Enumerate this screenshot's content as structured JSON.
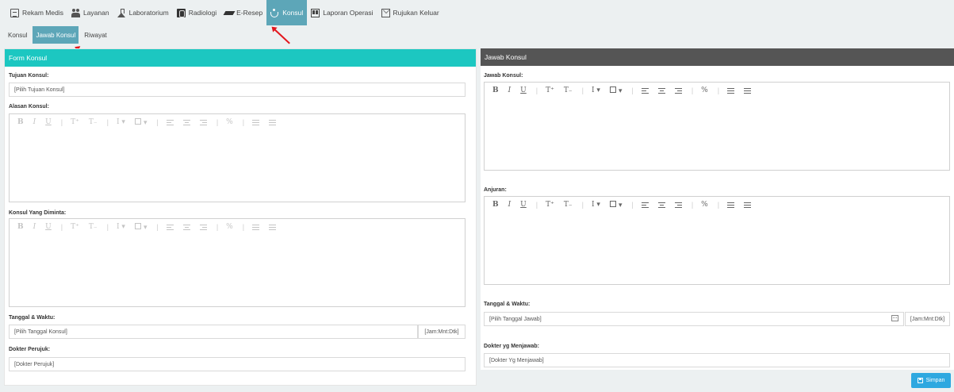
{
  "topnav": {
    "items": [
      {
        "label": "Rekam Medis",
        "icon": "document-icon"
      },
      {
        "label": "Layanan",
        "icon": "people-icon"
      },
      {
        "label": "Laboratorium",
        "icon": "flask-icon"
      },
      {
        "label": "Radiologi",
        "icon": "radiology-icon"
      },
      {
        "label": "E-Resep",
        "icon": "pen-icon"
      },
      {
        "label": "Konsul",
        "icon": "accessibility-icon"
      },
      {
        "label": "Laporan Operasi",
        "icon": "report-icon"
      },
      {
        "label": "Rujukan Keluar",
        "icon": "mail-icon"
      }
    ],
    "active": "Konsul"
  },
  "subtabs": {
    "items": [
      "Konsul",
      "Jawab Konsul",
      "Riwayat"
    ],
    "active": "Jawab Konsul"
  },
  "form_konsul": {
    "title": "Form Konsul",
    "tujuan_label": "Tujuan Konsul:",
    "tujuan_placeholder": "[Pilih Tujuan Konsul]",
    "alasan_label": "Alasan Konsul:",
    "diminta_label": "Konsul Yang Diminta:",
    "tanggal_label": "Tanggal & Waktu:",
    "tanggal_placeholder": "[Pilih Tanggal Konsul]",
    "jam_placeholder": "[Jam:Mnt:Dtk]",
    "dokter_label": "Dokter Perujuk:",
    "dokter_placeholder": "[Dokter Perujuk]"
  },
  "jawab_konsul": {
    "title": "Jawab Konsul",
    "jawab_label": "Jawab Konsul:",
    "anjuran_label": "Anjuran:",
    "tanggal_label": "Tanggal & Waktu:",
    "tanggal_placeholder": "[Pilih Tanggal Jawab]",
    "jam_placeholder": "[Jam:Mnt:Dtk]",
    "dokter_label": "Dokter yg Menjawab:",
    "dokter_placeholder": "[Dokter Yg Menjawab]",
    "save_label": "Simpan"
  },
  "colors": {
    "accent_active": "#5da6b8",
    "form_header": "#1cc7c1",
    "jawab_header": "#555555",
    "save_button": "#2ea8e0",
    "annotation_arrow": "#e3161d"
  }
}
